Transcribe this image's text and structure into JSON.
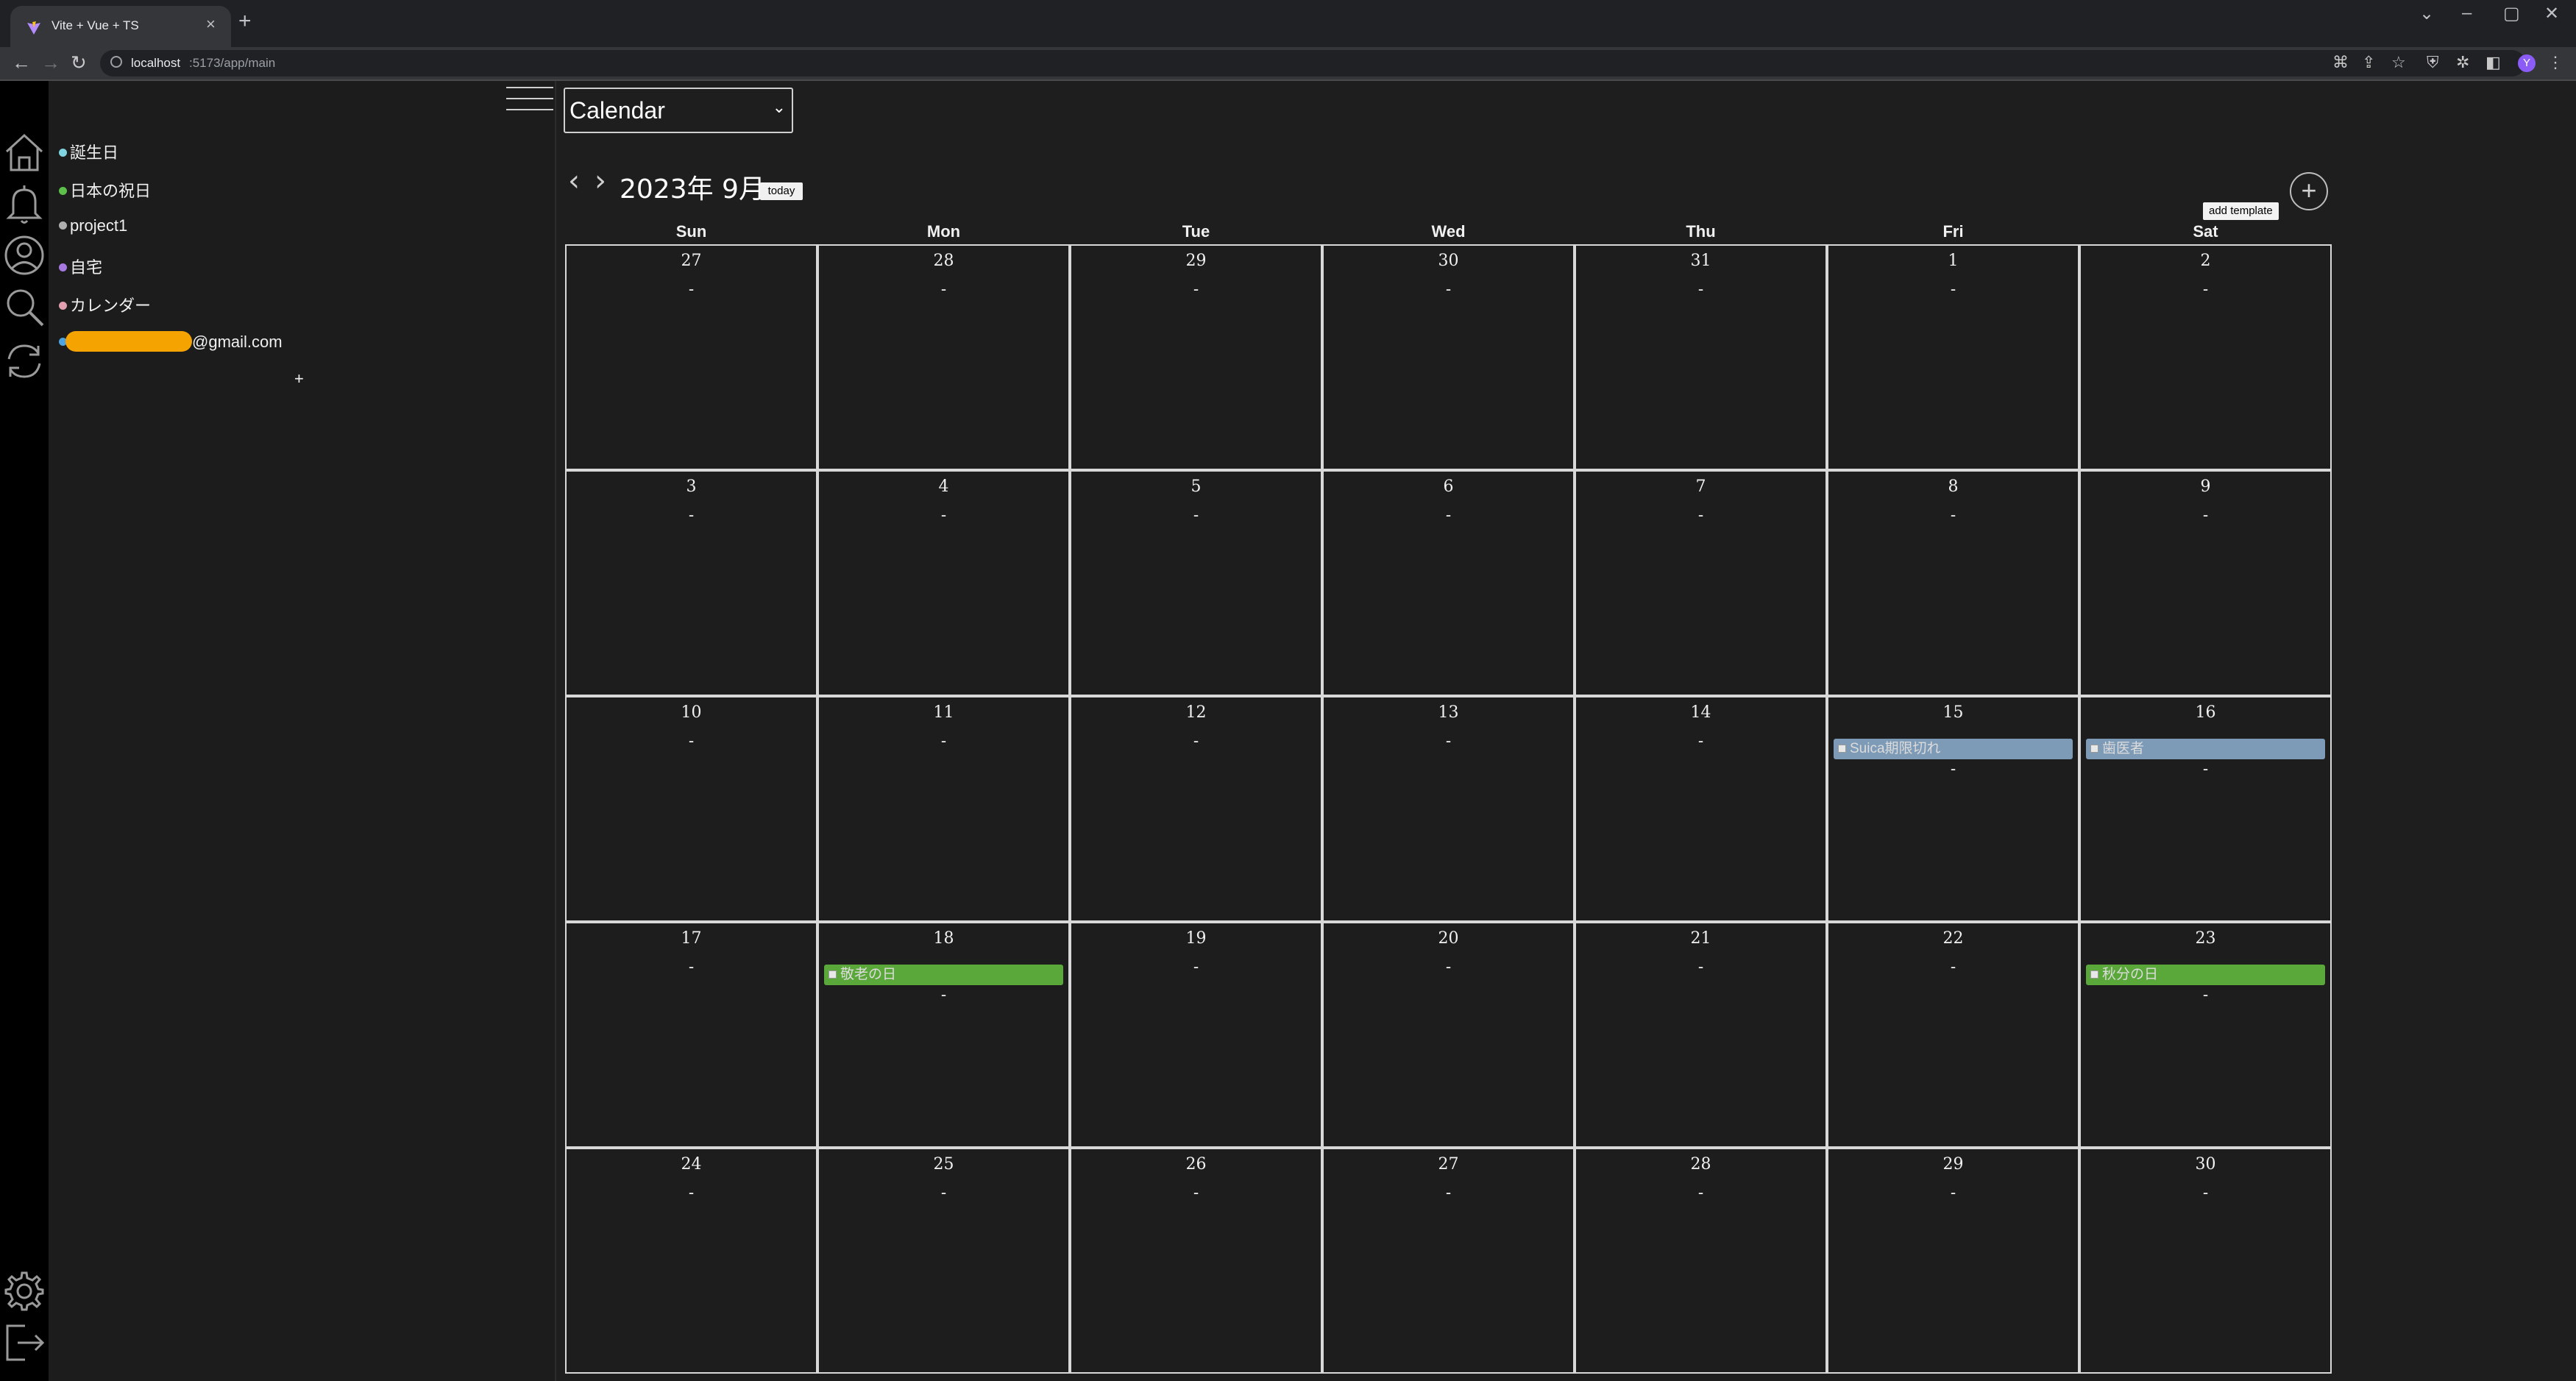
{
  "browser": {
    "tab_title": "Vite + Vue + TS",
    "url_host": "localhost",
    "url_rest": ":5173/app/main",
    "profile_initial": "Y"
  },
  "icons": {
    "iconbar": [
      "home-icon",
      "bell-icon",
      "user-icon",
      "search-icon",
      "sync-icon",
      "gear-icon",
      "logout-icon"
    ]
  },
  "sidebar": {
    "calendars": [
      {
        "label": "誕生日",
        "color": "#7fd4e0"
      },
      {
        "label": "日本の祝日",
        "color": "#5cc04a"
      },
      {
        "label": "project1",
        "color": "#b0b0b0"
      },
      {
        "label": "自宅",
        "color": "#a678e0"
      },
      {
        "label": "カレンダー",
        "color": "#e0a0b0"
      },
      {
        "label": "@gmail.com",
        "color": "#4ea3e0"
      }
    ],
    "add_label": "+"
  },
  "header": {
    "view_select": "Calendar",
    "prev": "‹",
    "next": "›",
    "month_title": "2023年 9月",
    "today_label": "today",
    "add_button": "+",
    "tooltip": "add template"
  },
  "calendar": {
    "weekdays": [
      "Sun",
      "Mon",
      "Tue",
      "Wed",
      "Thu",
      "Fri",
      "Sat"
    ],
    "empty_marker": "-",
    "weeks": [
      [
        {
          "day": "27"
        },
        {
          "day": "28"
        },
        {
          "day": "29"
        },
        {
          "day": "30"
        },
        {
          "day": "31"
        },
        {
          "day": "1"
        },
        {
          "day": "2"
        }
      ],
      [
        {
          "day": "3"
        },
        {
          "day": "4"
        },
        {
          "day": "5"
        },
        {
          "day": "6"
        },
        {
          "day": "7"
        },
        {
          "day": "8"
        },
        {
          "day": "9"
        }
      ],
      [
        {
          "day": "10"
        },
        {
          "day": "11"
        },
        {
          "day": "12"
        },
        {
          "day": "13"
        },
        {
          "day": "14"
        },
        {
          "day": "15",
          "event": {
            "title": "Suica期限切れ",
            "color": "#7d9ab6"
          }
        },
        {
          "day": "16",
          "event": {
            "title": "歯医者",
            "color": "#7d9ab6"
          }
        }
      ],
      [
        {
          "day": "17"
        },
        {
          "day": "18",
          "event": {
            "title": "敬老の日",
            "color": "#5aa83a"
          }
        },
        {
          "day": "19"
        },
        {
          "day": "20"
        },
        {
          "day": "21"
        },
        {
          "day": "22"
        },
        {
          "day": "23",
          "event": {
            "title": "秋分の日",
            "color": "#5aa83a"
          }
        }
      ],
      [
        {
          "day": "24"
        },
        {
          "day": "25"
        },
        {
          "day": "26"
        },
        {
          "day": "27"
        },
        {
          "day": "28"
        },
        {
          "day": "29"
        },
        {
          "day": "30"
        }
      ]
    ]
  }
}
